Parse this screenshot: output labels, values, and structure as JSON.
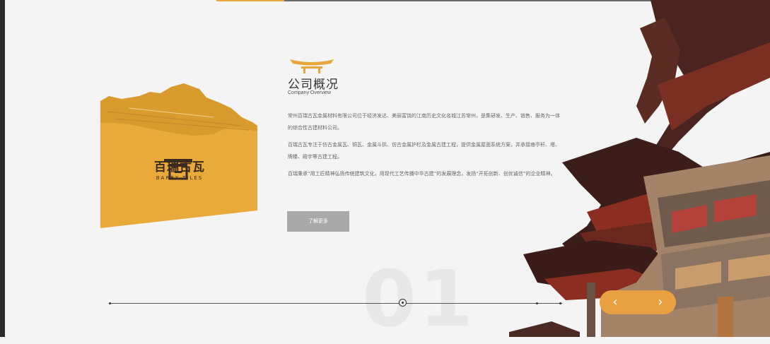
{
  "section": {
    "title_cn": "公司概况",
    "title_en": "Company Overview",
    "paragraphs": [
      "常州百瑞古瓦金属材料有限公司位于经济发达、美丽富饶的江南历史文化名城江苏常州，是集研发、生产、销售、服务为一体的综合性古建材料公司。",
      "百瑞古瓦专注于仿古金属瓦、铜瓦、金属斗拱、仿古金属护栏及金属古建工程，提供金属屋面系统方案，并承接瘗亭轩、塔、牌楼、殿宇等古建工程。",
      "百瑞秉承“用工匠精神弘扬传统建筑文化，用现代工艺传播中华古建”的发展理念，发扬“开拓创新、创优诚信”的企业精神。"
    ],
    "more_button": "了解更多"
  },
  "brand": {
    "name_cn": "百瑞古瓦",
    "name_en": "BARRY TILES"
  },
  "slider": {
    "current": "01",
    "prev_icon": "chevron-left-icon",
    "next_icon": "chevron-right-icon",
    "prev_symbol": "‹",
    "next_symbol": "›"
  },
  "colors": {
    "accent": "#e9a63b",
    "nav": "#e9a040",
    "button": "#a9a9a9",
    "roof_red": "#8b2e21"
  }
}
